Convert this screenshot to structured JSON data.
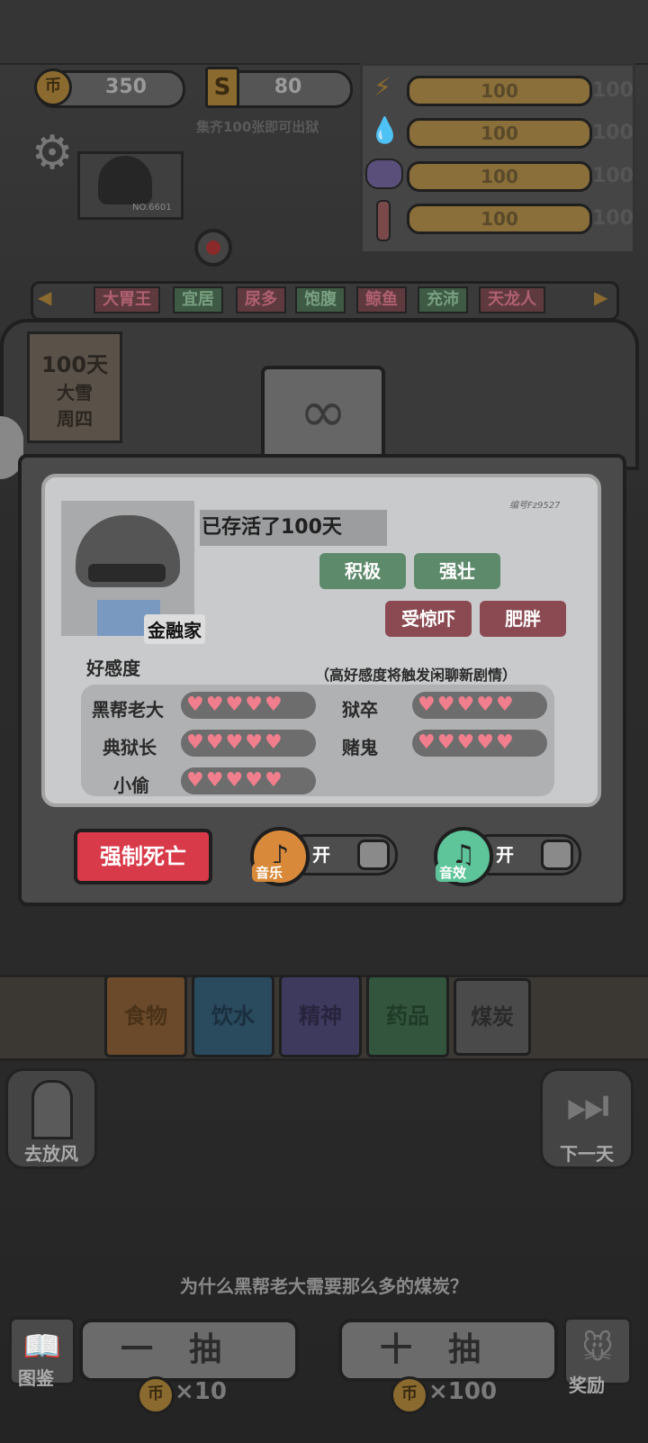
{
  "hud": {
    "coins": "350",
    "s_label": "S",
    "tickets": "80",
    "collect_hint": "集齐100张即可出狱",
    "coin_symbol": "币"
  },
  "stats": [
    {
      "icon": "energy-icon",
      "value": "100",
      "side": "100"
    },
    {
      "icon": "water-drop-icon",
      "value": "100",
      "side": "100"
    },
    {
      "icon": "brain-icon",
      "value": "100",
      "side": "100"
    },
    {
      "icon": "thermometer-icon",
      "value": "100",
      "side": "100"
    }
  ],
  "photo_id": "NO.6601",
  "traits_bar": [
    "大胃王",
    "宜居",
    "尿多",
    "饱腹",
    "鲸鱼",
    "充沛",
    "天龙人"
  ],
  "calendar": {
    "days": "100天",
    "weather": "大雪",
    "weekday": "周四"
  },
  "card": {
    "serial": "编号Fz9527",
    "survived": "已存活了100天",
    "job": "金融家",
    "good_tags": [
      "积极",
      "强壮"
    ],
    "bad_tags": [
      "受惊吓",
      "肥胖"
    ],
    "favor_title": "好感度",
    "favor_hint": "（高好感度将触发闲聊新剧情）",
    "favor": [
      {
        "name": "黑帮老大",
        "hearts": 5
      },
      {
        "name": "狱卒",
        "hearts": 5
      },
      {
        "name": "典狱长",
        "hearts": 5
      },
      {
        "name": "赌鬼",
        "hearts": 5
      },
      {
        "name": "小偷",
        "hearts": 5
      }
    ]
  },
  "controls": {
    "force_death": "强制死亡",
    "music_label": "音乐",
    "music_state": "开",
    "sfx_label": "音效",
    "sfx_state": "开"
  },
  "categories": [
    "食物",
    "饮水",
    "精神",
    "药品",
    "煤炭"
  ],
  "nav": {
    "left": "去放风",
    "right": "下一天"
  },
  "question": "为什么黑帮老大需要那么多的煤炭？",
  "bottom": {
    "gallery": "图鉴",
    "draw_one": "一抽",
    "draw_one_cost": "×10",
    "draw_ten": "十抽",
    "draw_ten_cost": "×100",
    "reward": "奖励"
  },
  "colors": {
    "good_tag": "#5e8a6c",
    "bad_tag": "#8b4a52",
    "danger": "#d93a4a",
    "heart": "#f07e8d"
  }
}
